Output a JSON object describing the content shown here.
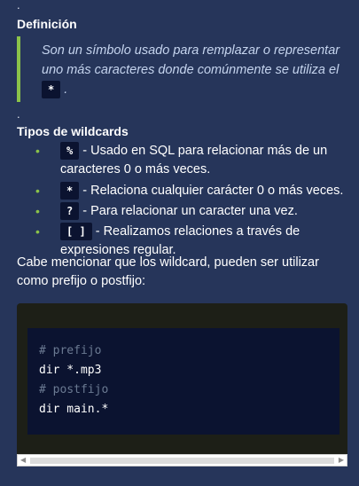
{
  "definition": {
    "dot": ".",
    "heading": "Definición",
    "text_before": "Son un símbolo usado para remplazar o representar uno más caracteres donde comúnmente se utiliza el",
    "code": "*",
    "text_after": "."
  },
  "types": {
    "dot": ".",
    "heading": "Tipos de wildcards",
    "items": [
      {
        "code": "%",
        "text": " - Usado en SQL para relacionar más de un caracteres 0 o más veces."
      },
      {
        "code": "*",
        "text": " - Relaciona cualquier carácter 0 o más veces."
      },
      {
        "code": "?",
        "text": " - Para relacionar un caracter una vez."
      },
      {
        "code": "[ ]",
        "text": " - Realizamos relaciones a través de expresiones regular."
      }
    ]
  },
  "paragraph": "Cabe mencionar que los wildcard, pueden ser utilizar como prefijo o postfijo:",
  "code_block": {
    "lines": [
      "# prefijo",
      "dir *.mp3",
      "# postfijo",
      "dir main.*"
    ]
  },
  "colors": {
    "background": "#26355a",
    "accent_green": "#8bc34a",
    "code_bg": "#0b1330"
  }
}
